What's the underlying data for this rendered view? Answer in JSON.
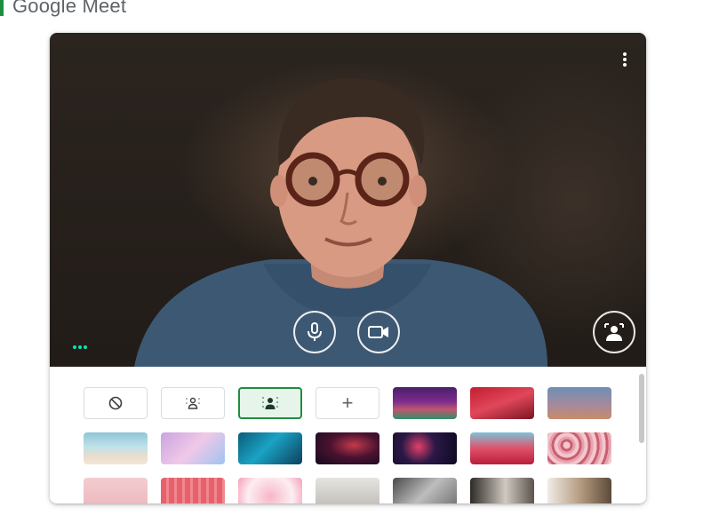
{
  "app": {
    "title": "Google Meet"
  },
  "preview": {
    "more_options_icon": "kebab-vertical-icon",
    "mic_icon": "microphone-icon",
    "camera_icon": "video-camera-icon",
    "effects_icon": "backdrop-effects-icon",
    "audio_level_icon": "audio-indicator-dots"
  },
  "background_options": [
    {
      "name": "no-effect-option",
      "icon": "block-icon"
    },
    {
      "name": "slight-blur-option",
      "icon": "blur-person-light-icon"
    },
    {
      "name": "blur-option",
      "icon": "blur-person-strong-icon",
      "selected": true
    },
    {
      "name": "add-background-option",
      "label": "+"
    }
  ],
  "colors": {
    "selected_border": "#1e8e3e",
    "selected_fill": "#e6f4ea",
    "audio_dots": "#00e6b8"
  }
}
